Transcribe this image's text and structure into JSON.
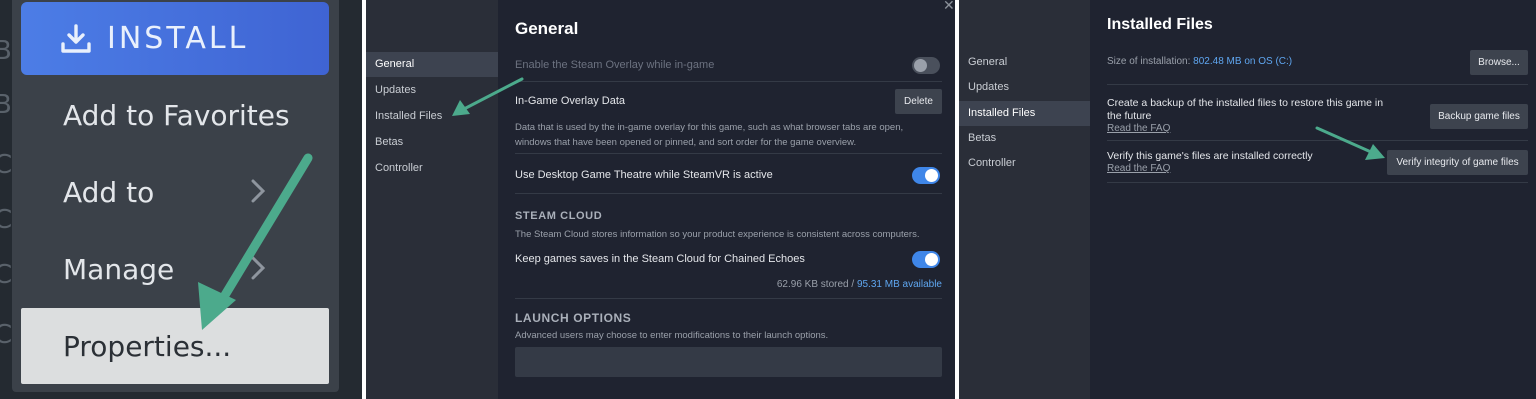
{
  "colors": {
    "install_blue": "#4570df",
    "arrow_green": "#4caa8c",
    "toggle_on": "#3f86e8",
    "link_blue": "#5fa6f0",
    "panel_bg": "#1f2330"
  },
  "context_menu": {
    "install_label": "INSTALL",
    "install_icon": "download-icon",
    "items": [
      {
        "label": "Add to Favorites",
        "has_submenu": false
      },
      {
        "label": "Add to",
        "has_submenu": true
      },
      {
        "label": "Manage",
        "has_submenu": true
      },
      {
        "label": "Properties...",
        "has_submenu": false,
        "selected": true
      }
    ]
  },
  "general_panel": {
    "close_glyph": "✕",
    "nav": [
      "General",
      "Updates",
      "Installed Files",
      "Betas",
      "Controller"
    ],
    "active_nav": "General",
    "title": "General",
    "overlay_toggle_label": "Enable the Steam Overlay while in-game",
    "overlay_toggle_on": false,
    "overlay_data_label": "In-Game Overlay Data",
    "delete_button": "Delete",
    "overlay_data_desc": "Data that is used by the in-game overlay for this game, such as what browser tabs are open, windows that have been opened or pinned, and sort order for the game overview.",
    "theatre_label": "Use Desktop Game Theatre while SteamVR is active",
    "theatre_on": true,
    "cloud_header": "STEAM CLOUD",
    "cloud_desc": "The Steam Cloud stores information so your product experience is consistent across computers.",
    "cloud_toggle_label": "Keep games saves in the Steam Cloud for Chained Echoes",
    "cloud_on": true,
    "stored": "62.96 KB stored",
    "separator": "/",
    "available": "95.31 MB available",
    "launch_header": "LAUNCH OPTIONS",
    "launch_desc": "Advanced users may choose to enter modifications to their launch options.",
    "launch_value": ""
  },
  "installed_panel": {
    "nav": [
      "General",
      "Updates",
      "Installed Files",
      "Betas",
      "Controller"
    ],
    "active_nav": "Installed Files",
    "title": "Installed Files",
    "size_label": "Size of installation:",
    "size_value": "802.48 MB on OS (C:)",
    "browse_button": "Browse...",
    "backup_text": "Create a backup of the installed files to restore this game in the future",
    "backup_link": "Read the FAQ",
    "backup_button": "Backup game files",
    "verify_text": "Verify this game's files are installed correctly",
    "verify_link": "Read the FAQ",
    "verify_button": "Verify integrity of game files"
  }
}
